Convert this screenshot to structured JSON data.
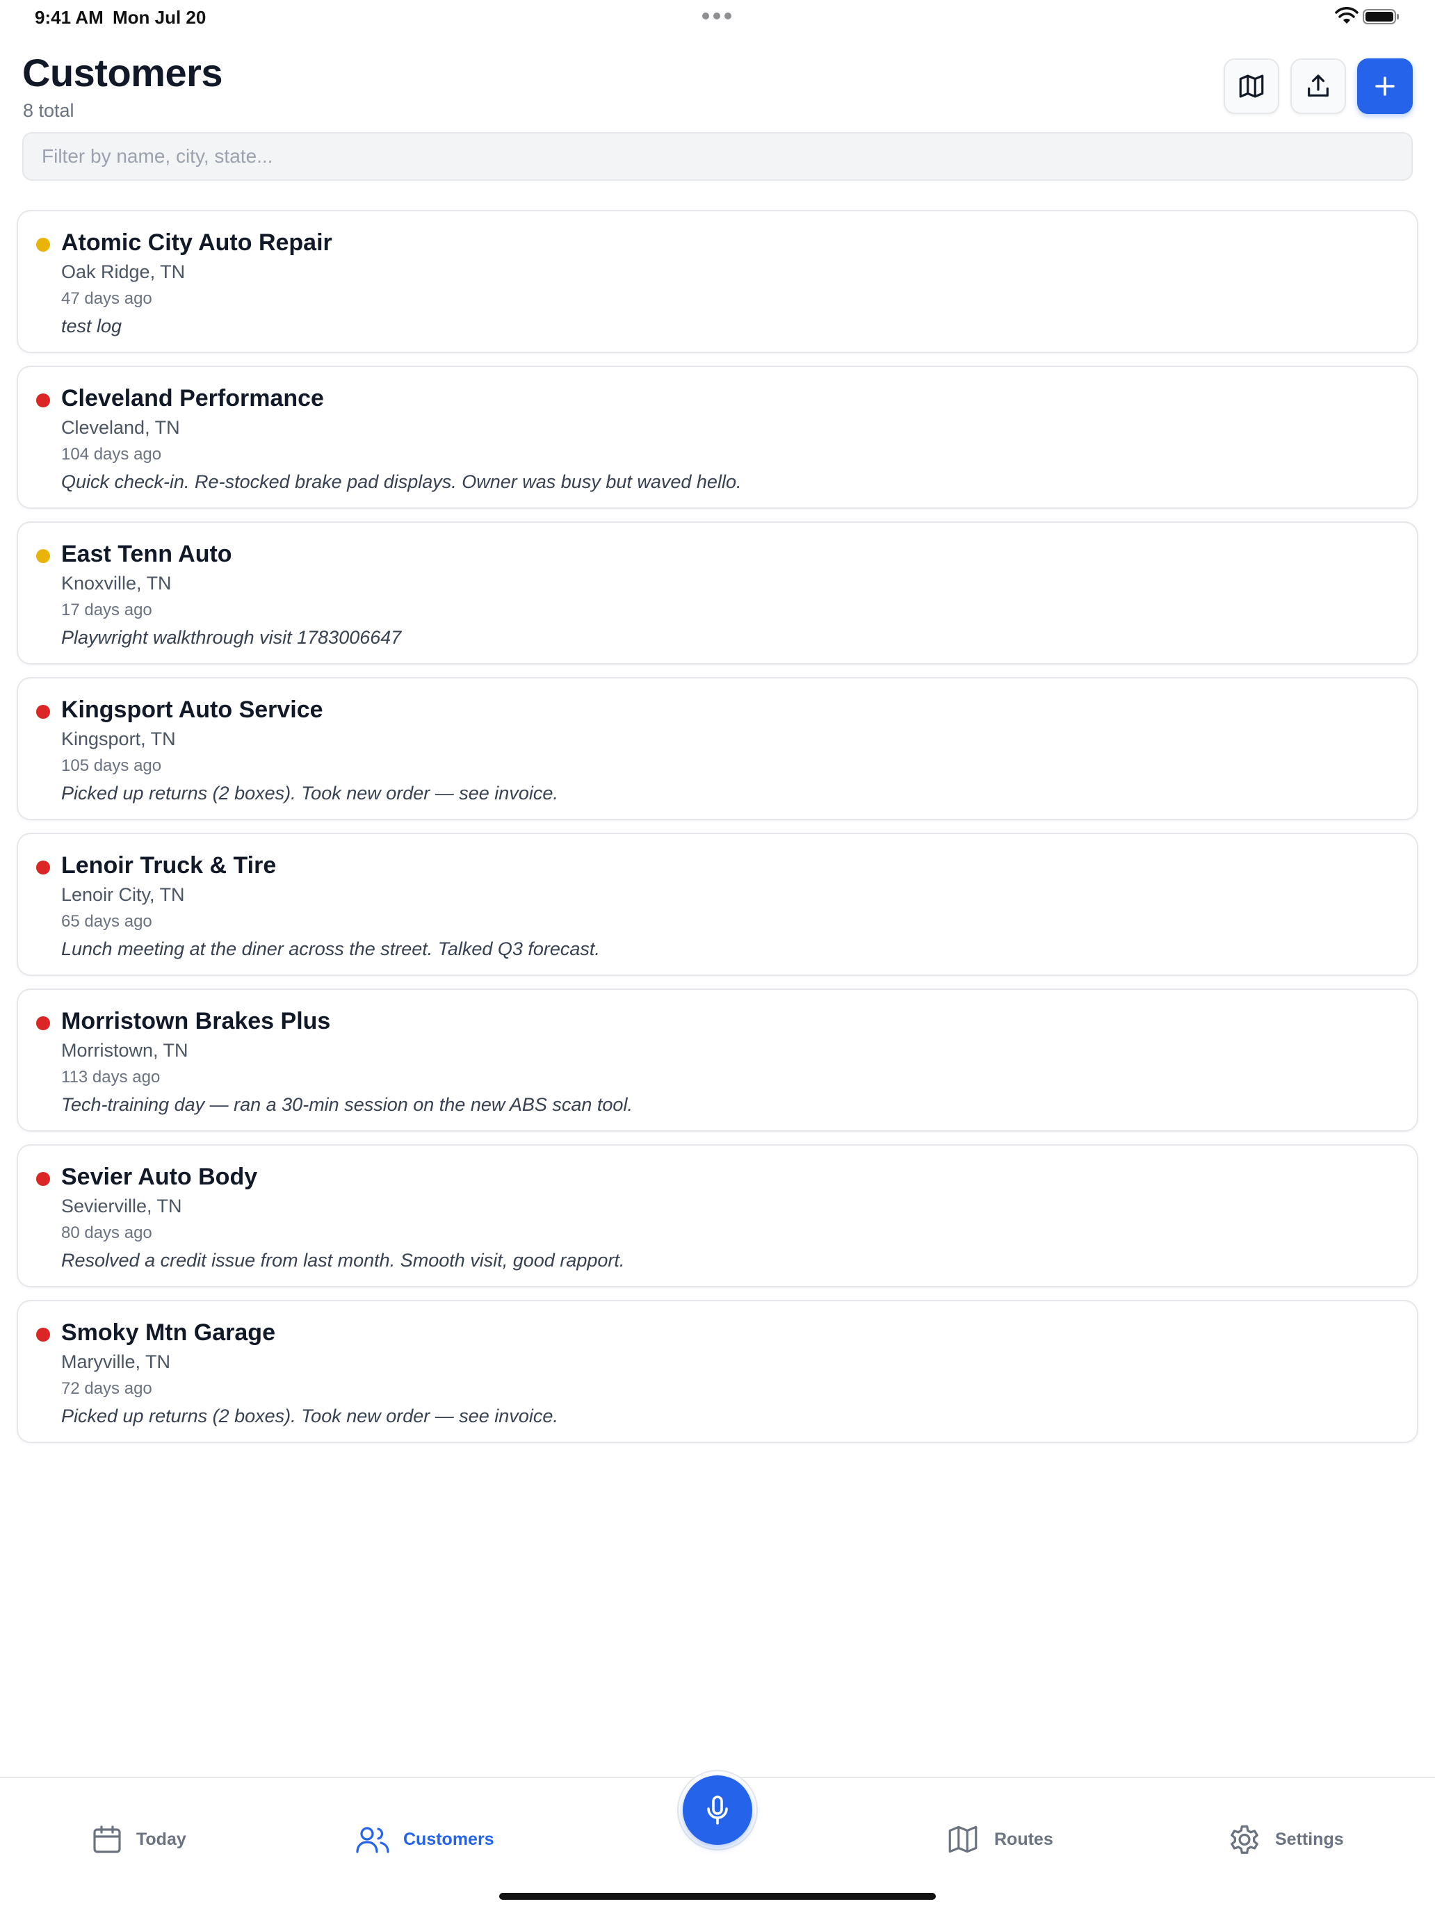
{
  "status_bar": {
    "time": "9:41 AM",
    "date": "Mon Jul 20"
  },
  "header": {
    "title": "Customers",
    "subtitle": "8 total"
  },
  "search": {
    "placeholder": "Filter by name, city, state...",
    "value": ""
  },
  "colors": {
    "accent": "#2563eb",
    "status_warning": "#eab308",
    "status_overdue": "#dc2626"
  },
  "customers": [
    {
      "name": "Atomic City Auto Repair",
      "location": "Oak Ridge, TN",
      "last_visit": "47 days ago",
      "note": "test log",
      "status": "warning"
    },
    {
      "name": "Cleveland Performance",
      "location": "Cleveland, TN",
      "last_visit": "104 days ago",
      "note": "Quick check-in. Re-stocked brake pad displays. Owner was busy but waved hello.",
      "status": "overdue"
    },
    {
      "name": "East Tenn Auto",
      "location": "Knoxville, TN",
      "last_visit": "17 days ago",
      "note": "Playwright walkthrough visit 1783006647",
      "status": "warning"
    },
    {
      "name": "Kingsport Auto Service",
      "location": "Kingsport, TN",
      "last_visit": "105 days ago",
      "note": "Picked up returns (2 boxes). Took new order — see invoice.",
      "status": "overdue"
    },
    {
      "name": "Lenoir Truck & Tire",
      "location": "Lenoir City, TN",
      "last_visit": "65 days ago",
      "note": "Lunch meeting at the diner across the street. Talked Q3 forecast.",
      "status": "overdue"
    },
    {
      "name": "Morristown Brakes Plus",
      "location": "Morristown, TN",
      "last_visit": "113 days ago",
      "note": "Tech-training day — ran a 30-min session on the new ABS scan tool.",
      "status": "overdue"
    },
    {
      "name": "Sevier Auto Body",
      "location": "Sevierville, TN",
      "last_visit": "80 days ago",
      "note": "Resolved a credit issue from last month. Smooth visit, good rapport.",
      "status": "overdue"
    },
    {
      "name": "Smoky Mtn Garage",
      "location": "Maryville, TN",
      "last_visit": "72 days ago",
      "note": "Picked up returns (2 boxes). Took new order — see invoice.",
      "status": "overdue"
    }
  ],
  "tabbar": {
    "today": "Today",
    "customers": "Customers",
    "routes": "Routes",
    "settings": "Settings",
    "active": "customers"
  },
  "icons": [
    "map-icon",
    "share-icon",
    "plus-icon",
    "calendar-icon",
    "users-icon",
    "microphone-icon",
    "map-icon",
    "gear-icon",
    "wifi-icon",
    "battery-icon"
  ]
}
